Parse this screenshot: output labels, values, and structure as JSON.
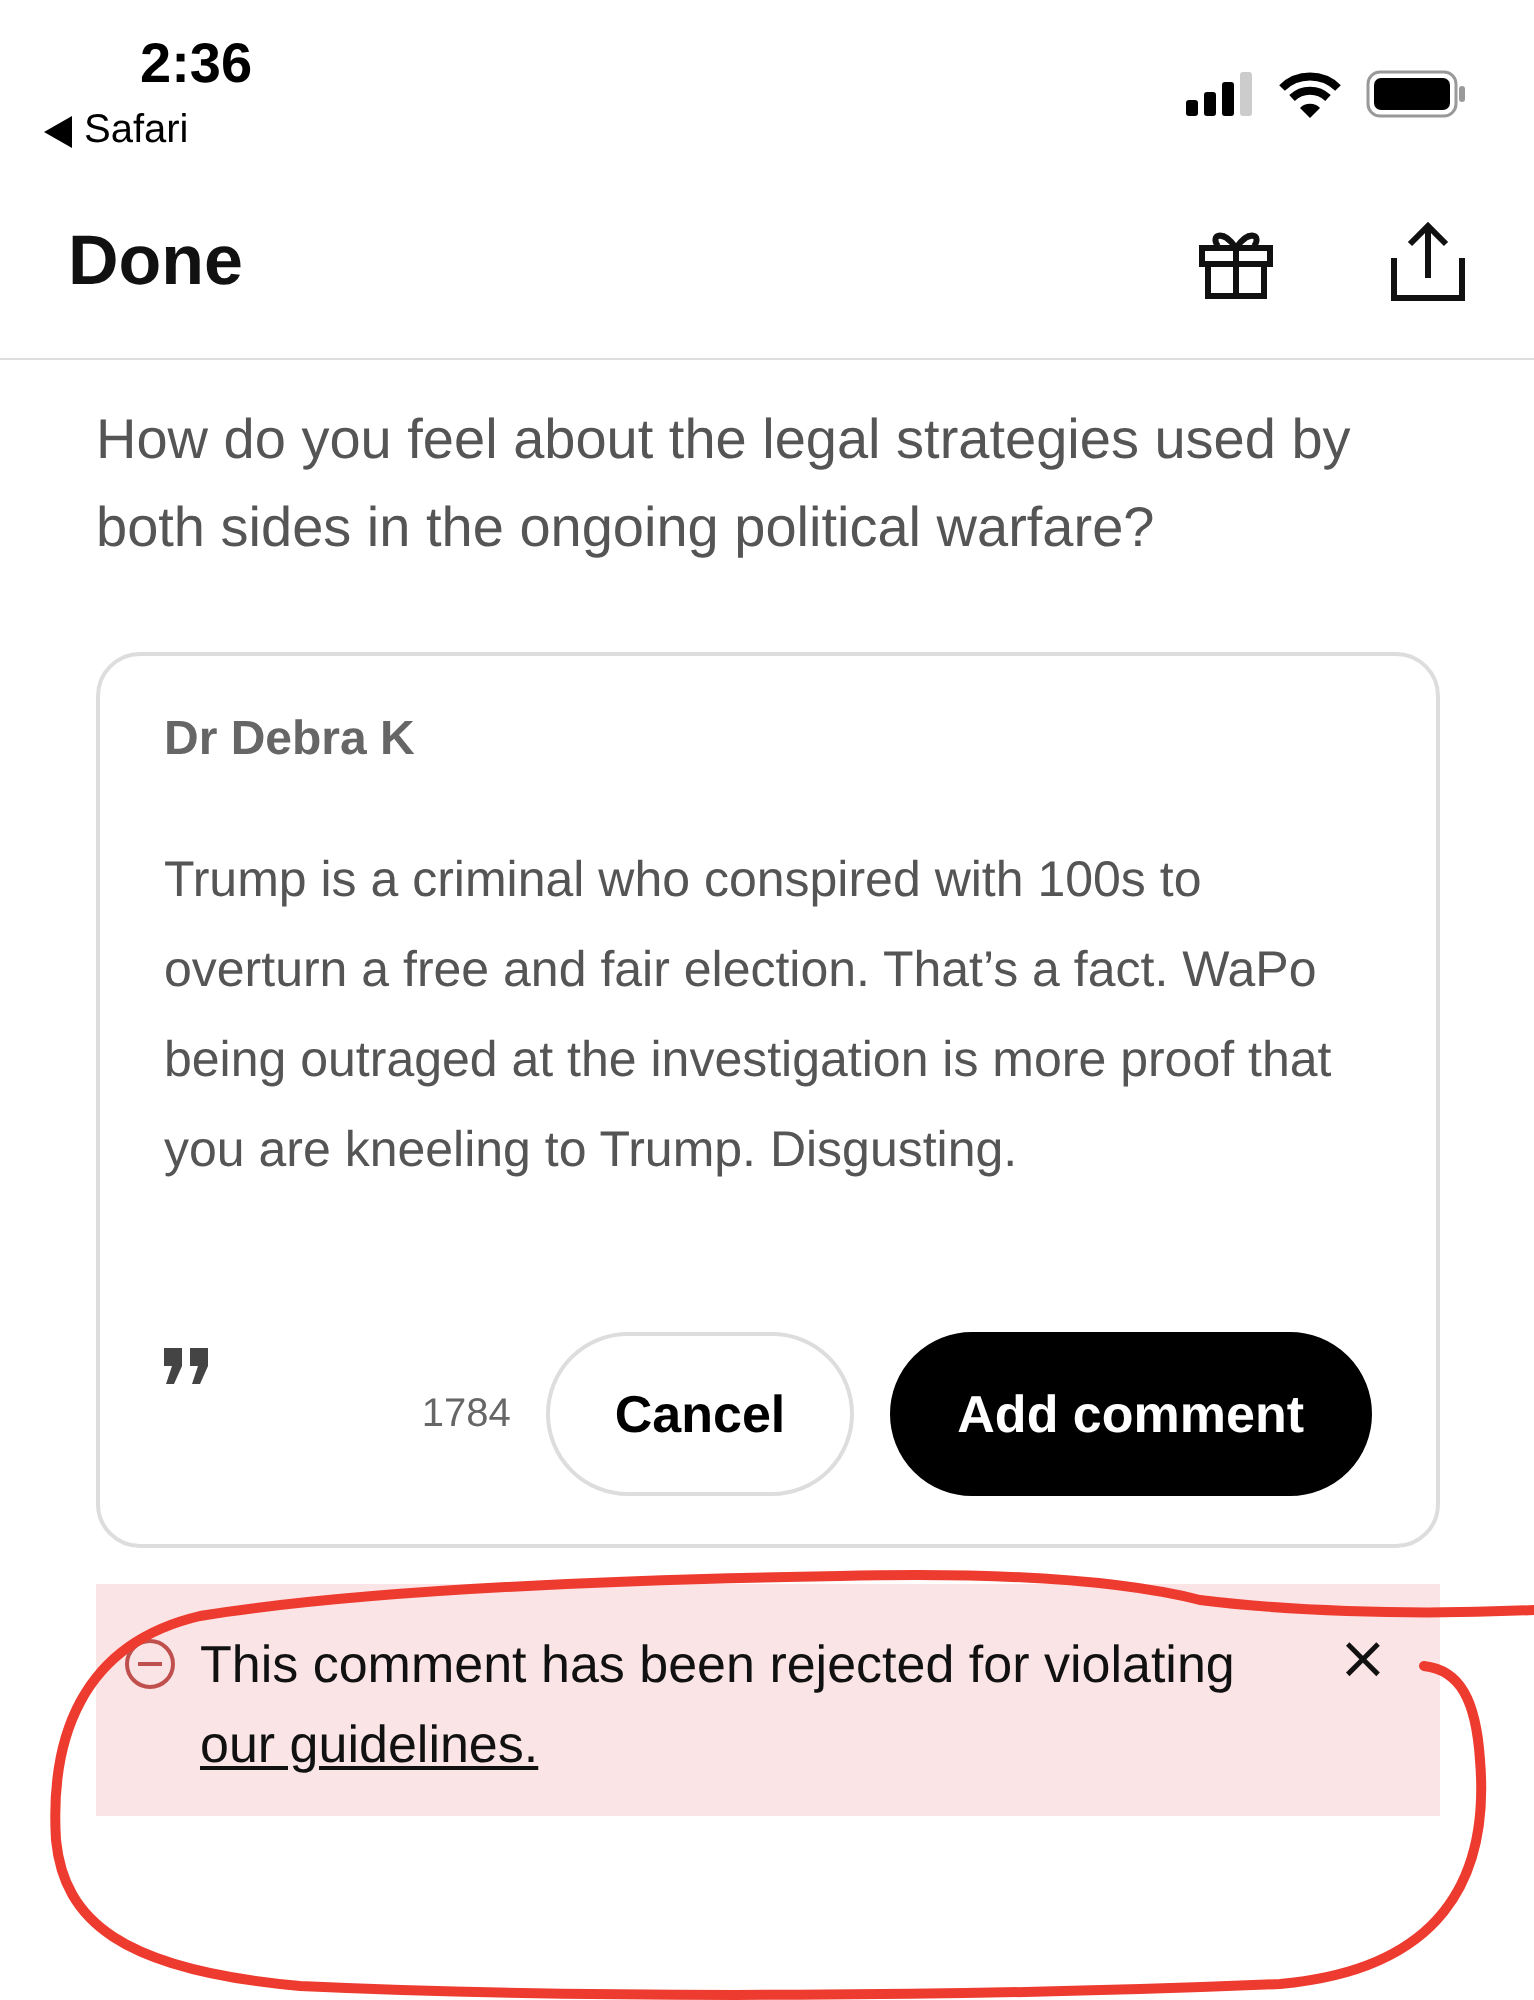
{
  "status_bar": {
    "time": "2:36",
    "back_label": "Safari"
  },
  "nav": {
    "title": "Done"
  },
  "question": "How do you feel about the legal strategies used by both sides in the ongoing political warfare?",
  "comment_form": {
    "author": "Dr Debra K",
    "text": "Trump is a criminal who conspired with 100s to overturn a free and fair election. That’s a fact. WaPo being outraged at the investigation is more proof that you are kneeling to Trump. Disgusting.",
    "char_count": "1784",
    "buttons": [
      {
        "label": "Cancel",
        "kind": "secondary"
      },
      {
        "label": "Add comment",
        "kind": "primary"
      }
    ]
  },
  "alert": {
    "message": "This comment has been rejected for violating",
    "link": "our guidelines.",
    "close": "×"
  }
}
